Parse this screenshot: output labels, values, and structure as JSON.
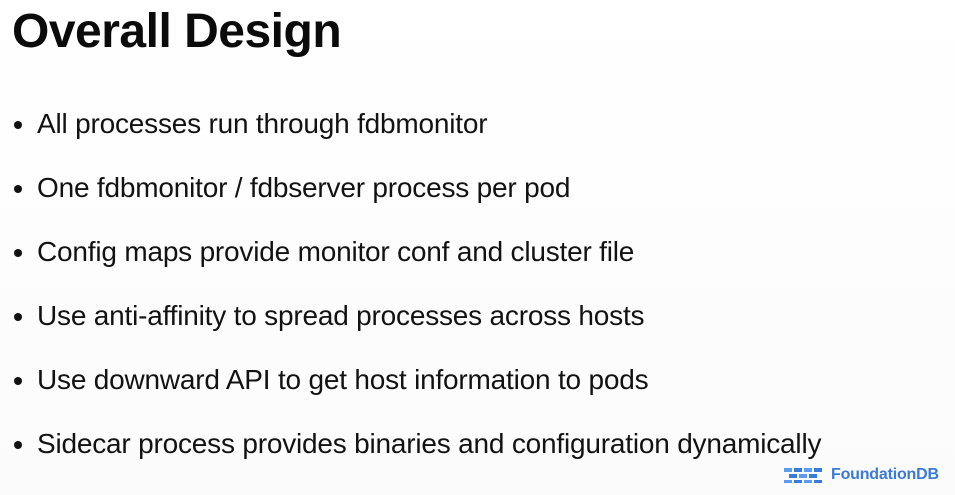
{
  "slide": {
    "title": "Overall Design",
    "bullets": [
      "All processes run through fdbmonitor",
      "One fdbmonitor / fdbserver process per pod",
      "Config maps provide monitor conf and cluster file",
      "Use anti-affinity to spread processes across hosts",
      "Use downward API to get host information to pods",
      "Sidecar process provides binaries and configuration dynamically"
    ],
    "brand": {
      "icon": "foundationdb-logo-icon",
      "name": "FoundationDB",
      "color": "#3a7ad9"
    }
  }
}
